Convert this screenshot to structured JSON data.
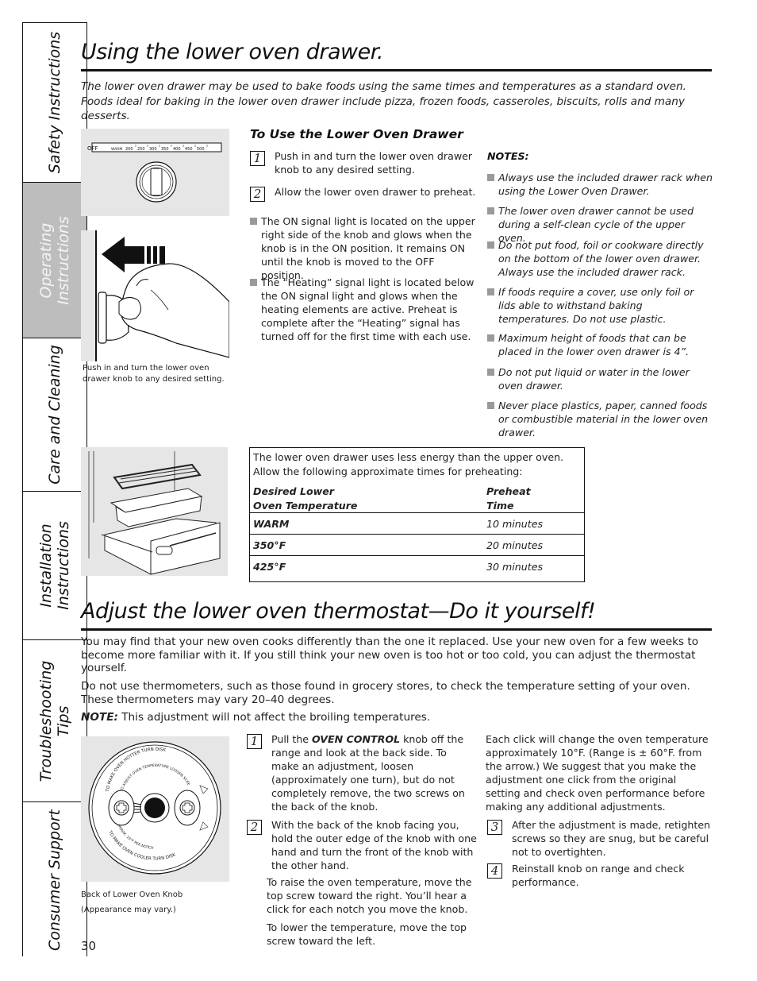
{
  "sidebar": {
    "tabs": [
      {
        "label": "Safety Instructions",
        "active": false
      },
      {
        "label": "Operating\nInstructions",
        "active": true
      },
      {
        "label": "Care and Cleaning",
        "active": false
      },
      {
        "label": "Installation\nInstructions",
        "active": false
      },
      {
        "label": "Troubleshooting\nTips",
        "active": false
      },
      {
        "label": "Consumer Support",
        "active": false
      }
    ]
  },
  "section1": {
    "title": "Using the lower oven drawer.",
    "intro": "The lower oven drawer may be used to bake foods using the same times and temperatures as a standard oven. Foods ideal for baking in the lower oven drawer include pizza, frozen foods, casseroles, biscuits, rolls and many desserts.",
    "knob_dial": {
      "off_label": "OFF",
      "warm_label": "WARM",
      "temps": [
        "200",
        "250",
        "300",
        "350",
        "400",
        "450",
        "500"
      ]
    },
    "hand_caption": "Push in and turn the lower oven drawer knob to any desired setting.",
    "subhead": "To Use the Lower Oven Drawer",
    "steps": [
      {
        "num": "1",
        "text": "Push in and turn the lower oven drawer knob to any desired setting."
      },
      {
        "num": "2",
        "text": "Allow the lower oven drawer to preheat."
      }
    ],
    "bullets": [
      "The ON signal light is located on the upper right side of the knob and glows when the knob is in the ON position. It remains ON until the knob is moved to the OFF position.",
      "The “Heating” signal light is located below the ON signal light and glows when the heating elements are active. Preheat is complete after the “Heating” signal has turned off for the first time with each use."
    ],
    "notes_title": "NOTES:",
    "notes": [
      "Always use the included drawer rack when using the Lower Oven Drawer.",
      "The lower oven drawer cannot be used during a self-clean cycle of the upper oven.",
      "Do not put food, foil or cookware directly on the bottom of the lower oven drawer. Always use the included drawer rack.",
      "If foods require a cover, use only foil or lids able to withstand baking temperatures. Do not use plastic.",
      "Maximum height of foods that can be placed in the lower oven drawer is 4”.",
      "Do not put liquid or water in the lower oven drawer.",
      "Never place plastics, paper, canned foods or combustible material in the lower oven drawer."
    ],
    "preheat_table": {
      "lead": "The lower oven drawer uses less energy than the upper oven. Allow the following approximate times for preheating:",
      "headers": [
        "Desired Lower\nOven Temperature",
        "Preheat\nTime"
      ],
      "rows": [
        [
          "WARM",
          "10 minutes"
        ],
        [
          "350°F",
          "20 minutes"
        ],
        [
          "425°F",
          "30 minutes"
        ]
      ]
    }
  },
  "section2": {
    "title": "Adjust the lower oven thermostat—Do it yourself!",
    "para1": "You may find that your new oven cooks differently than the one it replaced. Use your new oven for a few weeks to become more familiar with it. If you still think your new oven is too hot or too cold, you can adjust the thermostat yourself.",
    "para2": "Do not use thermometers, such as those found in grocery stores, to check the temperature setting of your oven. These thermometers may vary 20–40 degrees.",
    "note_label": "NOTE:",
    "note_text": " This adjustment will not affect the broiling temperatures.",
    "knob_back": {
      "hotter_text": "TO MAKE OVEN HOTTER TURN DISK",
      "adjust_text": "TO ADJUST OVEN TEMPERATURE LOOSEN SCREWS AND ROTATE",
      "approx_text": "APPROX. 10°F PER NOTCH",
      "cooler_text": "TO MAKE OVEN COOLER TURN DISK"
    },
    "knob_caption_1": "Back of Lower Oven Knob",
    "knob_caption_2": "(Appearance may vary.)",
    "step1_pre": "Pull the ",
    "step1_bold": "OVEN CONTROL",
    "step1_post": " knob off the range and look at the back side. To make an adjustment, loosen (approximately one turn), but do not completely remove, the two screws on the back of the knob.",
    "step2": "With the back of the knob facing you, hold the outer edge of the knob with one hand and turn the front of the knob with the other hand.",
    "raise_text": "To raise the oven temperature, move the top screw toward the right. You’ll hear a click for each notch you move the knob.",
    "lower_text": "To lower the temperature, move the top screw toward the left.",
    "click_text": "Each click will change the oven temperature approximately 10°F. (Range is ± 60°F. from the arrow.) We suggest that you make the adjustment one click from the original setting and check oven performance before making any additional adjustments.",
    "step3": "After the adjustment is made, retighten screws so they are snug, but be careful not to overtighten.",
    "step4": "Reinstall knob on range and check performance.",
    "step_nums": [
      "1",
      "2",
      "3",
      "4"
    ]
  },
  "page_number": "30"
}
